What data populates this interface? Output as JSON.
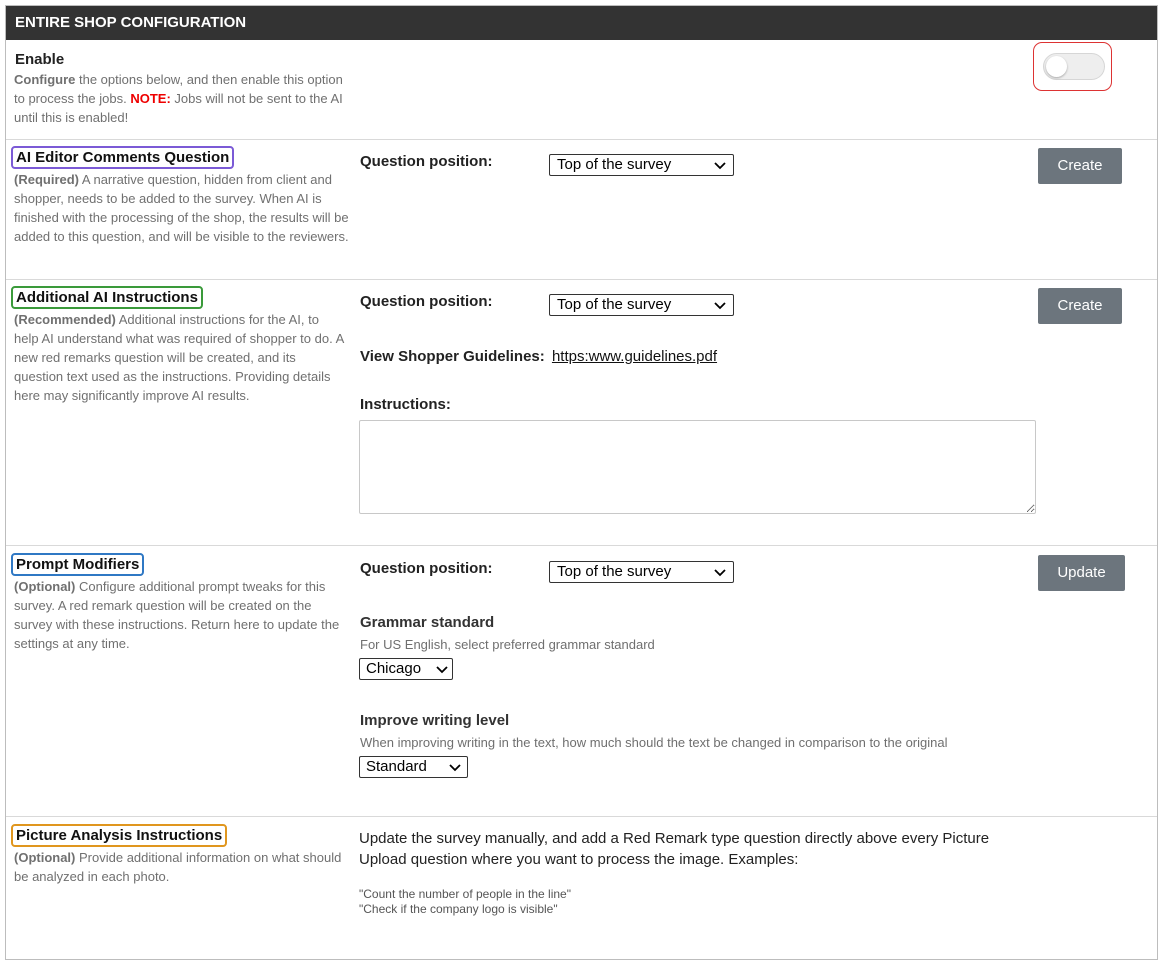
{
  "header": {
    "title": "ENTIRE SHOP CONFIGURATION"
  },
  "enable": {
    "title": "Enable",
    "desc_lead": "Configure",
    "desc_mid": " the options below, and then enable this option to process the jobs. ",
    "note_label": "NOTE:",
    "desc_tail": " Jobs will not be sent to the AI until this is enabled!",
    "toggle_on": false,
    "toggle_highlight_color": "#d33333"
  },
  "editor_comments": {
    "title": "AI Editor Comments Question",
    "border_color": "#7b5ad6",
    "desc_lead": "(Required)",
    "desc_tail": " A narrative question, hidden from client and shopper, needs to be added to the survey. When AI is finished with the processing of the shop, the results will be added to this question, and will be visible to the reviewers.",
    "position_label": "Question position:",
    "position_value": "Top of the survey",
    "button_label": "Create"
  },
  "additional": {
    "title": "Additional AI Instructions",
    "border_color": "#3a9a3a",
    "desc_lead": "(Recommended)",
    "desc_tail": " Additional instructions for the AI, to help AI understand what was required of shopper to do. A new red remarks question will be created, and its question text used as the instructions. Providing details here may significantly improve AI results.",
    "position_label": "Question position:",
    "position_value": "Top of the survey",
    "button_label": "Create",
    "guidelines_label": "View Shopper Guidelines:",
    "guidelines_link": "https:www.guidelines.pdf",
    "instructions_label": "Instructions:",
    "instructions_value": ""
  },
  "prompt": {
    "title": "Prompt Modifiers",
    "border_color": "#2f78c4",
    "desc_lead": "(Optional)",
    "desc_tail": " Configure additional prompt tweaks for this survey. A red remark question will be created on the survey with these instructions. Return here to update the settings at any time.",
    "position_label": "Question position:",
    "position_value": "Top of the survey",
    "button_label": "Update",
    "grammar_title": "Grammar standard",
    "grammar_hint": "For US English, select preferred grammar standard",
    "grammar_value": "Chicago",
    "writing_title": "Improve writing level",
    "writing_hint": "When improving writing in the text, how much should the text be changed in comparison to the original",
    "writing_value": "Standard"
  },
  "picture": {
    "title": "Picture Analysis Instructions",
    "border_color": "#e0961e",
    "desc_lead": "(Optional)",
    "desc_tail": " Provide additional information on what should be analyzed in each photo.",
    "text": "Update the survey manually, and add a Red Remark type question directly above every Picture Upload question where you want to process the image. Examples:",
    "example1": "\"Count the number of people in the line\"",
    "example2": "\"Check if the company logo is visible\""
  }
}
